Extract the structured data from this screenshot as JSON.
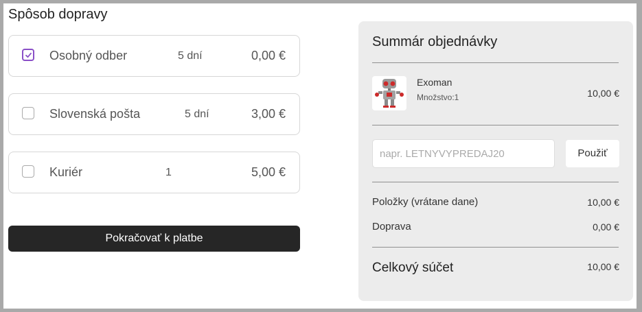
{
  "shipping": {
    "title": "Spôsob dopravy",
    "options": [
      {
        "name": "Osobný odber",
        "days": "5 dní",
        "price": "0,00 €",
        "selected": true
      },
      {
        "name": "Slovenská pošta",
        "days": "5 dní",
        "price": "3,00 €",
        "selected": false
      },
      {
        "name": "Kuriér",
        "days": "1",
        "price": "5,00 €",
        "selected": false
      }
    ],
    "continue_label": "Pokračovať k platbe"
  },
  "summary": {
    "title": "Summár objednávky",
    "product": {
      "name": "Exoman",
      "quantity": "Množstvo:1",
      "price": "10,00 €",
      "image_icon": "robot-icon"
    },
    "coupon": {
      "placeholder": "napr. LETNYVYPREDAJ20",
      "value": "",
      "apply_label": "Použiť"
    },
    "items_label": "Položky (vrátane dane)",
    "items_value": "10,00 €",
    "shipping_label": "Doprava",
    "shipping_value": "0,00 €",
    "total_label": "Celkový súčet",
    "total_value": "10,00 €"
  },
  "colors": {
    "accent": "#8a4fc7",
    "button_dark": "#262626",
    "summary_bg": "#ececec"
  }
}
